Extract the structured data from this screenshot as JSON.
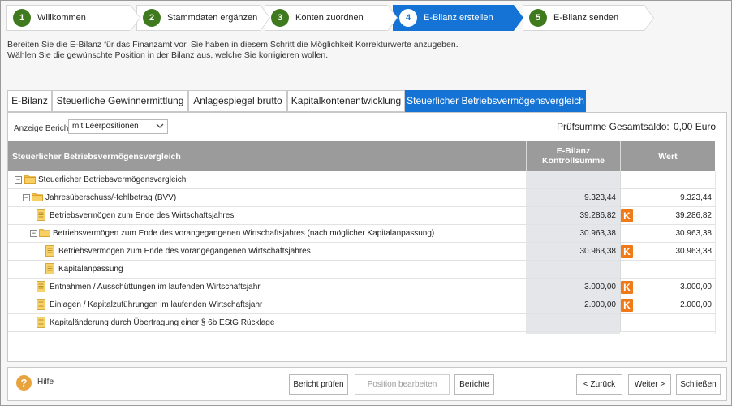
{
  "wizard": {
    "steps": [
      {
        "num": "1",
        "label": "Willkommen"
      },
      {
        "num": "2",
        "label": "Stammdaten ergänzen"
      },
      {
        "num": "3",
        "label": "Konten zuordnen"
      },
      {
        "num": "4",
        "label": "E-Bilanz erstellen",
        "active": true
      },
      {
        "num": "5",
        "label": "E-Bilanz senden"
      }
    ]
  },
  "intro": {
    "line1": "Bereiten Sie die E-Bilanz für das Finanzamt vor. Sie haben in diesem Schritt die Möglichkeit Korrekturwerte anzugeben.",
    "line2": "Wählen Sie die gewünschte Position in der Bilanz aus, welche Sie korrigieren wollen."
  },
  "tabs": [
    {
      "label": "E-Bilanz"
    },
    {
      "label": "Steuerliche Gewinnermittlung"
    },
    {
      "label": "Anlagespiegel brutto"
    },
    {
      "label": "Kapitalkontenentwicklung"
    },
    {
      "label": "Steuerlicher Betriebsvermögensvergleich",
      "active": true
    }
  ],
  "report": {
    "anzeige_label": "Anzeige Bericht:",
    "anzeige_value": "mit Leerpositionen",
    "pruefsumme_label": "Prüfsumme Gesamtsaldo:",
    "pruefsumme_value": "0,00  Euro"
  },
  "table": {
    "headers": {
      "name": "Steuerlicher Betriebsvermögensvergleich",
      "kontroll_line1": "E-Bilanz",
      "kontroll_line2": "Kontrollsumme",
      "wert": "Wert"
    },
    "rows": [
      {
        "label": "Steuerlicher Betriebsvermögensvergleich",
        "kontroll": "",
        "k": false,
        "wert": ""
      },
      {
        "label": "Jahresüberschuss/-fehlbetrag (BVV)",
        "kontroll": "9.323,44",
        "k": false,
        "wert": "9.323,44"
      },
      {
        "label": "Betriebsvermögen zum Ende des Wirtschaftsjahres",
        "kontroll": "39.286,82",
        "k": true,
        "wert": "39.286,82"
      },
      {
        "label": "Betriebsvermögen zum Ende des vorangegangenen Wirtschaftsjahres (nach möglicher Kapitalanpassung)",
        "kontroll": "30.963,38",
        "k": false,
        "wert": "30.963,38"
      },
      {
        "label": "Betriebsvermögen zum Ende des vorangegangenen Wirtschaftsjahres",
        "kontroll": "30.963,38",
        "k": true,
        "wert": "30.963,38"
      },
      {
        "label": "Kapitalanpassung",
        "kontroll": "",
        "k": false,
        "wert": ""
      },
      {
        "label": "Entnahmen / Ausschüttungen im laufenden Wirtschaftsjahr",
        "kontroll": "3.000,00",
        "k": true,
        "wert": "3.000,00"
      },
      {
        "label": "Einlagen / Kapitalzuführungen im laufenden Wirtschaftsjahr",
        "kontroll": "2.000,00",
        "k": true,
        "wert": "2.000,00"
      },
      {
        "label": "Kapitaländerung durch Übertragung einer § 6b EStG Rücklage",
        "kontroll": "",
        "k": false,
        "wert": ""
      }
    ],
    "k_badge": "K"
  },
  "footer": {
    "help_icon": "?",
    "help": "Hilfe",
    "bericht_pruefen": "Bericht prüfen",
    "position_bearbeiten": "Position bearbeiten",
    "berichte": "Berichte",
    "zurueck": "< Zurück",
    "weiter": "Weiter >",
    "schliessen": "Schließen"
  },
  "colors": {
    "accent": "#1473d4",
    "step_done": "#3f7a1f",
    "k_badge": "#f07a17",
    "help": "#e8a33d",
    "header": "#9b9b9b"
  }
}
